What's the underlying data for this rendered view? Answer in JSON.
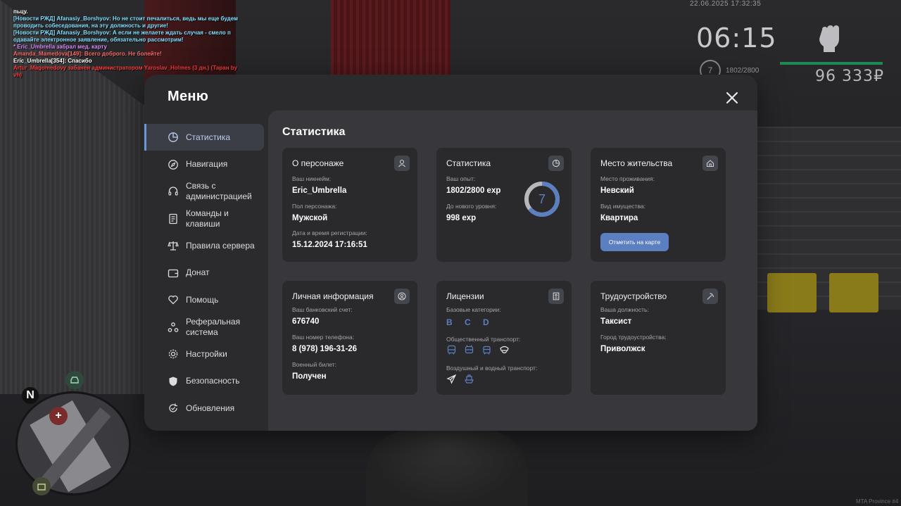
{
  "chat": [
    {
      "text": "пьцу.",
      "color": "#ffffff"
    },
    {
      "text": "[Новости РЖД] Afanasiy_Borshyov: Но не стоит печалиться, ведь мы еще будем",
      "color": "#7fe0ff"
    },
    {
      "text": "проводить собеседования, на эту должность и другие!",
      "color": "#7fe0ff"
    },
    {
      "text": "[Новости РЖД] Afanasiy_Borshyov: А если не желаете ждать случая - смело п",
      "color": "#7fe0ff"
    },
    {
      "text": "одавайте электронное заявление, обязательно рассмотрим!",
      "color": "#7fe0ff"
    },
    {
      "text": "* Eric_Umbrella забрал мед. карту",
      "color": "#d68cff"
    },
    {
      "text": "Amanda_Mamedova[149]: Всего доброго. Не болейте!",
      "color": "#ff6a6a"
    },
    {
      "text": "Eric_Umbrella[354]: Спасибо",
      "color": "#ffffff"
    },
    {
      "text": "Artur_Magomedovy забанен администратором Yaroslav_Holmes (3 дн.) (Таран by",
      "color": "#ff3b3b"
    },
    {
      "text": "vh)",
      "color": "#ff3b3b"
    }
  ],
  "hud": {
    "datetime": "22.06.2025 17:32:35",
    "time": "06:15",
    "level": "7",
    "exp": "1802/2800",
    "money": "96 333₽",
    "server": "MTA Province #4"
  },
  "menu": {
    "title": "Меню",
    "nav": [
      {
        "label": "Статистика",
        "icon": "pie-chart-icon",
        "active": true
      },
      {
        "label": "Навигация",
        "icon": "compass-icon"
      },
      {
        "label": "Связь с администрацией",
        "icon": "headset-icon"
      },
      {
        "label": "Команды и клавиши",
        "icon": "document-icon"
      },
      {
        "label": "Правила сервера",
        "icon": "scales-icon"
      },
      {
        "label": "Донат",
        "icon": "wallet-icon"
      },
      {
        "label": "Помощь",
        "icon": "heart-hand-icon"
      },
      {
        "label": "Реферальная система",
        "icon": "referral-icon"
      },
      {
        "label": "Настройки",
        "icon": "gear-icon"
      },
      {
        "label": "Безопасность",
        "icon": "shield-icon"
      },
      {
        "label": "Обновления",
        "icon": "refresh-icon"
      }
    ],
    "section_title": "Статистика",
    "cards": {
      "character": {
        "title": "О персонаже",
        "icon": "user-icon",
        "nickname_label": "Ваш никнейм:",
        "nickname": "Eric_Umbrella",
        "gender_label": "Пол персонажа:",
        "gender": "Мужской",
        "reg_label": "Дата и время регистрации:",
        "reg": "15.12.2024 17:16:51"
      },
      "stats": {
        "title": "Статистика",
        "icon": "pie-chart-icon",
        "exp_label": "Ваш опыт:",
        "exp": "1802/2800 exp",
        "next_label": "До нового уровня:",
        "next": "998 exp",
        "level": "7",
        "progress": 0.6436
      },
      "residence": {
        "title": "Место жительства",
        "icon": "home-icon",
        "place_label": "Место проживания:",
        "place": "Невский",
        "type_label": "Вид имущества:",
        "type": "Квартира",
        "button": "Отметить на карте"
      },
      "personal": {
        "title": "Личная информация",
        "icon": "user-circle-icon",
        "bank_label": "Ваш банковский счет:",
        "bank": "676740",
        "phone_label": "Ваш номер телефона:",
        "phone": "8 (978) 196-31-26",
        "military_label": "Военный билет:",
        "military": "Получен"
      },
      "licenses": {
        "title": "Лицензии",
        "icon": "id-card-icon",
        "base_label": "Базовые категории:",
        "base": "B C D",
        "public_label": "Общественный транспорт:",
        "air_label": "Воздушный и водный транспорт:"
      },
      "job": {
        "title": "Трудоустройство",
        "icon": "pickaxe-icon",
        "position_label": "Ваша должность:",
        "position": "Таксист",
        "city_label": "Город трудоустройства:",
        "city": "Приволжск"
      }
    }
  },
  "colors": {
    "accent": "#5b7fc0",
    "panel": "#2b2b2e",
    "content": "#38383c",
    "card": "#2a2a2d"
  }
}
